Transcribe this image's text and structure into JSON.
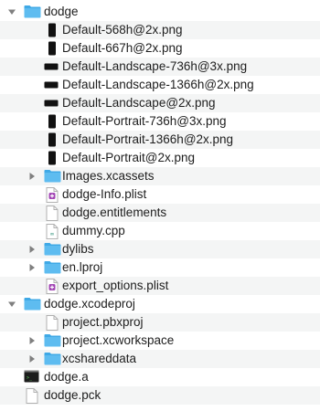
{
  "items": [
    {
      "label": "dodge",
      "depth": 0,
      "icon": "folder-icon",
      "disclosure": "expanded"
    },
    {
      "label": "Default-568h@2x.png",
      "depth": 1,
      "icon": "png-portrait-icon",
      "disclosure": "none"
    },
    {
      "label": "Default-667h@2x.png",
      "depth": 1,
      "icon": "png-portrait-icon",
      "disclosure": "none"
    },
    {
      "label": "Default-Landscape-736h@3x.png",
      "depth": 1,
      "icon": "png-landscape-icon",
      "disclosure": "none"
    },
    {
      "label": "Default-Landscape-1366h@2x.png",
      "depth": 1,
      "icon": "png-landscape-icon",
      "disclosure": "none"
    },
    {
      "label": "Default-Landscape@2x.png",
      "depth": 1,
      "icon": "png-landscape-icon",
      "disclosure": "none"
    },
    {
      "label": "Default-Portrait-736h@3x.png",
      "depth": 1,
      "icon": "png-portrait-icon",
      "disclosure": "none"
    },
    {
      "label": "Default-Portrait-1366h@2x.png",
      "depth": 1,
      "icon": "png-portrait-icon",
      "disclosure": "none"
    },
    {
      "label": "Default-Portrait@2x.png",
      "depth": 1,
      "icon": "png-portrait-icon",
      "disclosure": "none"
    },
    {
      "label": "Images.xcassets",
      "depth": 1,
      "icon": "folder-icon",
      "disclosure": "collapsed"
    },
    {
      "label": "dodge-Info.plist",
      "depth": 1,
      "icon": "plist-icon",
      "disclosure": "none"
    },
    {
      "label": "dodge.entitlements",
      "depth": 1,
      "icon": "document-icon",
      "disclosure": "none"
    },
    {
      "label": "dummy.cpp",
      "depth": 1,
      "icon": "cpp-file-icon",
      "disclosure": "none"
    },
    {
      "label": "dylibs",
      "depth": 1,
      "icon": "folder-icon",
      "disclosure": "collapsed"
    },
    {
      "label": "en.lproj",
      "depth": 1,
      "icon": "folder-icon",
      "disclosure": "collapsed"
    },
    {
      "label": "export_options.plist",
      "depth": 1,
      "icon": "plist-icon",
      "disclosure": "none"
    },
    {
      "label": "dodge.xcodeproj",
      "depth": 0,
      "icon": "folder-icon",
      "disclosure": "expanded"
    },
    {
      "label": "project.pbxproj",
      "depth": 1,
      "icon": "document-icon",
      "disclosure": "none"
    },
    {
      "label": "project.xcworkspace",
      "depth": 1,
      "icon": "folder-icon",
      "disclosure": "collapsed"
    },
    {
      "label": "xcshareddata",
      "depth": 1,
      "icon": "folder-icon",
      "disclosure": "collapsed"
    },
    {
      "label": "dodge.a",
      "depth": 0,
      "icon": "terminal-binary-icon",
      "disclosure": "none"
    },
    {
      "label": "dodge.pck",
      "depth": 0,
      "icon": "document-icon",
      "disclosure": "none"
    }
  ],
  "colors": {
    "folder": "#5ebcf0",
    "folderTab": "#3fa9e6",
    "disclosure": "#7f7f7f",
    "plist": "#a347b5",
    "cpp": "#1f8a70",
    "rowAlt": "#f4f5f5"
  }
}
